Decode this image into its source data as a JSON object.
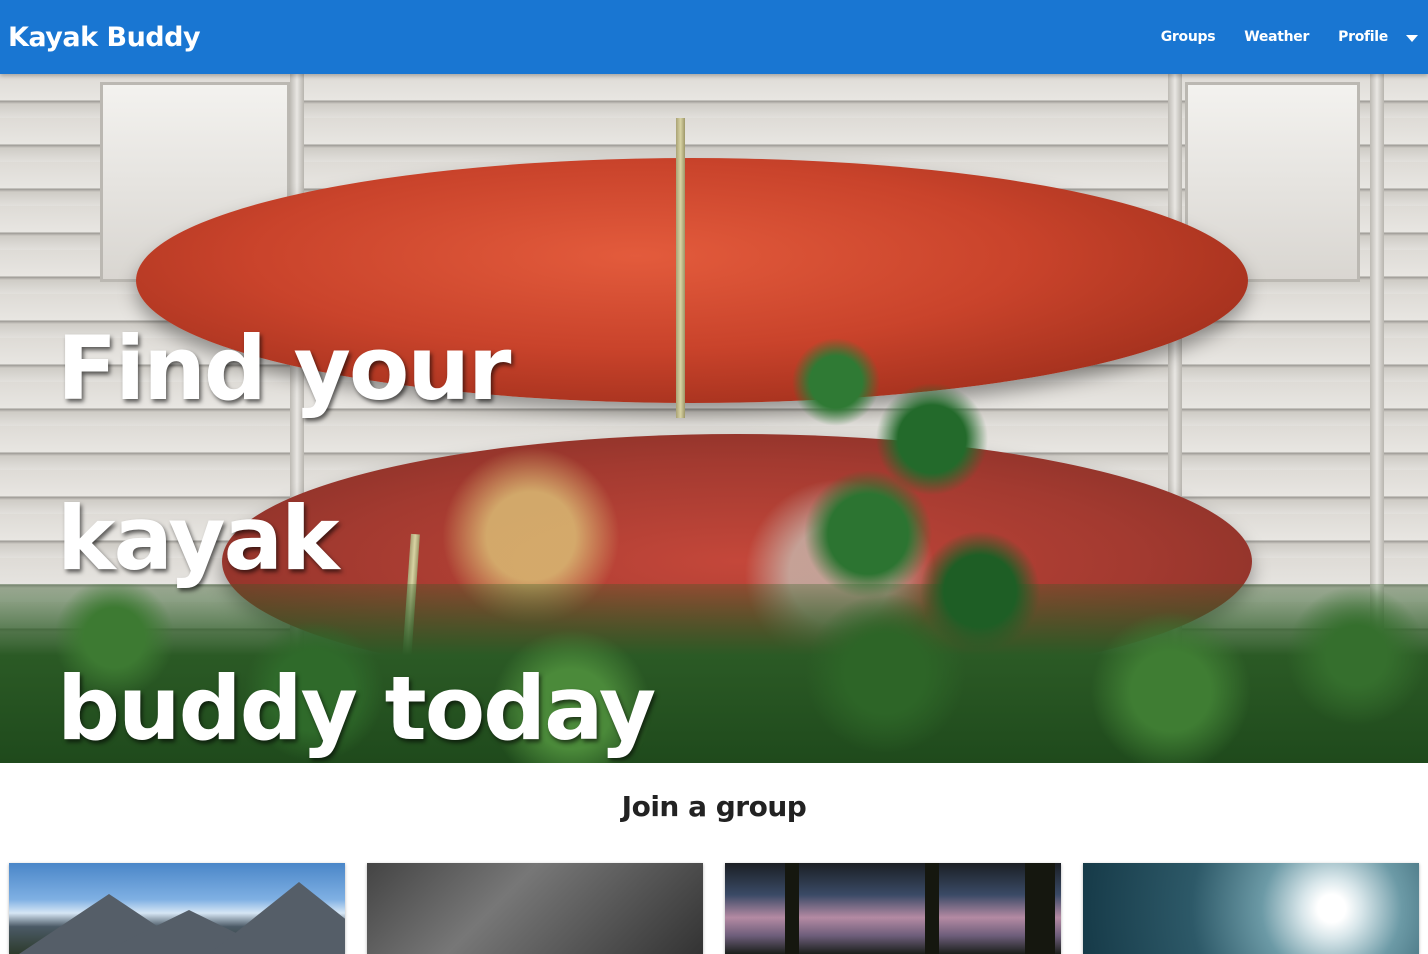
{
  "navbar": {
    "brand": "Kayak Buddy",
    "links": [
      "Groups",
      "Weather",
      "Profile"
    ],
    "background": "#1976d2"
  },
  "hero": {
    "title_line1": "Find your kayak",
    "title_line2": "buddy today"
  },
  "groups_section": {
    "title": "Join a group",
    "cards": [
      {
        "image": "mountains-photo"
      },
      {
        "image": "grayscale-photo"
      },
      {
        "image": "forest-sunset-photo"
      },
      {
        "image": "sun-sky-photo"
      }
    ]
  }
}
